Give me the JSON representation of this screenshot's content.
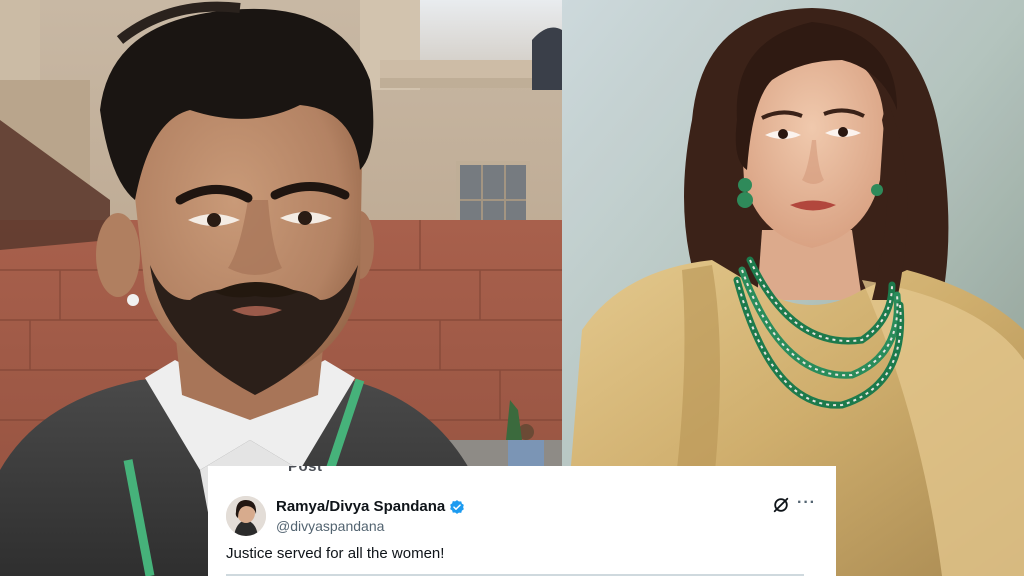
{
  "tweet": {
    "header_fragment": "Post",
    "display_name": "Ramya/Divya Spandana",
    "handle": "@divyaspandana",
    "text": "Justice served for all the women!",
    "verified": true,
    "verified_color": "#1d9bf0"
  },
  "icons": {
    "verified": "verified-check-icon",
    "grok": "grok-icon",
    "more": "more-horizontal-icon"
  }
}
